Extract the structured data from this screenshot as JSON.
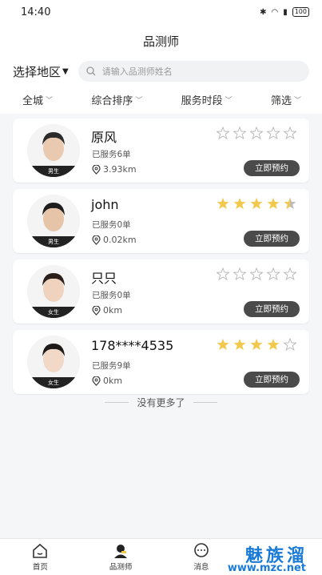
{
  "status_bar": {
    "time": "14:40",
    "battery": "100"
  },
  "nav": {
    "title": "品测师"
  },
  "search": {
    "region": "选择地区",
    "placeholder": "请输入品测师姓名"
  },
  "filters": [
    "全城",
    "综合排序",
    "服务时段",
    "筛选"
  ],
  "cards": [
    {
      "name": "原风",
      "gender": "男生",
      "served": "已服务6单",
      "distance": "3.93km",
      "stars": 0,
      "button": "立即预约"
    },
    {
      "name": "john",
      "gender": "男生",
      "served": "已服务0单",
      "distance": "0.02km",
      "stars": 4.5,
      "button": "立即预约"
    },
    {
      "name": "只只",
      "gender": "女生",
      "served": "已服务0单",
      "distance": "0km",
      "stars": 0,
      "button": "立即预约"
    },
    {
      "name": "178****4535",
      "gender": "女生",
      "served": "已服务9单",
      "distance": "0km",
      "stars": 4,
      "button": "立即预约"
    }
  ],
  "no_more": "没有更多了",
  "tabs": [
    {
      "label": "首页",
      "icon": "home-icon"
    },
    {
      "label": "品测师",
      "icon": "tester-icon"
    },
    {
      "label": "消息",
      "icon": "message-icon"
    }
  ],
  "watermark": {
    "title": "魅族溜",
    "url": "www.mzc.net"
  },
  "colors": {
    "star_filled": "#f2c94c",
    "star_empty": "#bbbbbb",
    "button": "#4a4a4a"
  }
}
